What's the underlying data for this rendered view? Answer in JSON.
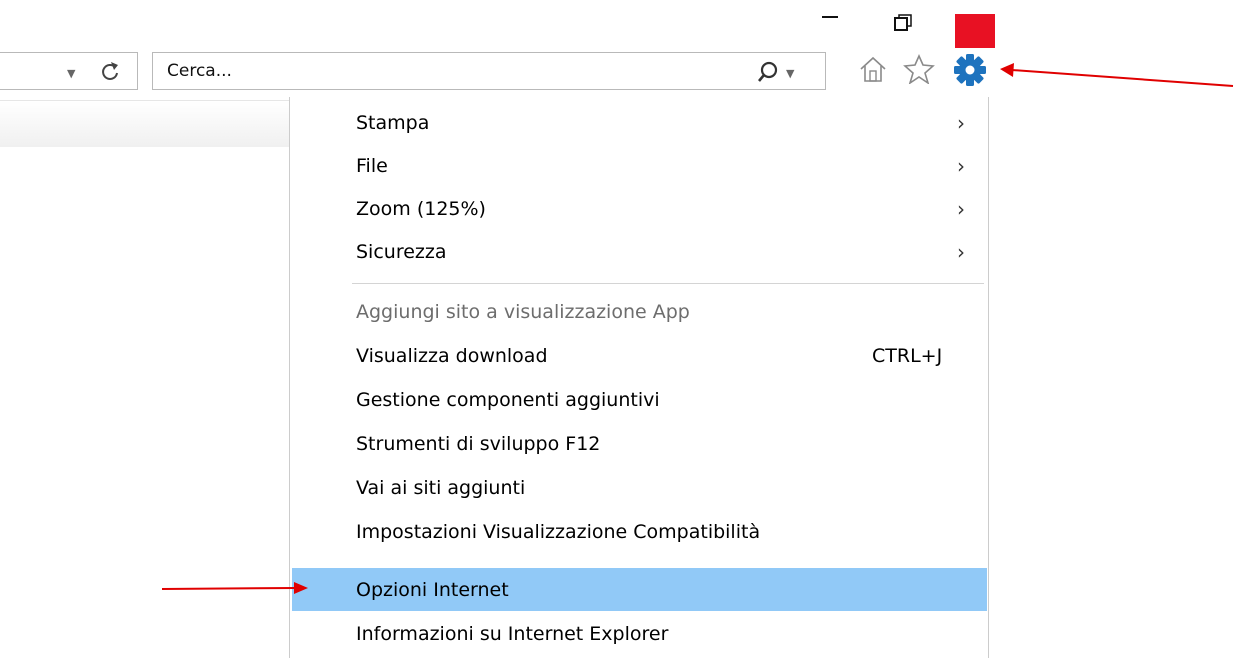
{
  "search": {
    "placeholder": "Cerca..."
  },
  "toolbar": {
    "icons": [
      "home-icon",
      "star-icon",
      "gear-icon"
    ],
    "gear_color": "#1e73be"
  },
  "window": {
    "close_color": "#e81123"
  },
  "menu": {
    "items": [
      {
        "label": "Stampa",
        "submenu": true
      },
      {
        "label": "File",
        "submenu": true
      },
      {
        "label": "Zoom (125%)",
        "submenu": true
      },
      {
        "label": "Sicurezza",
        "submenu": true
      },
      {
        "label": "Aggiungi sito a visualizzazione App",
        "disabled": true
      },
      {
        "label": "Visualizza download",
        "shortcut": "CTRL+J"
      },
      {
        "label": "Gestione componenti aggiuntivi"
      },
      {
        "label": "Strumenti di sviluppo F12"
      },
      {
        "label": "Vai ai siti aggiunti"
      },
      {
        "label": "Impostazioni Visualizzazione Compatibilità"
      },
      {
        "label": "Opzioni Internet",
        "highlighted": true
      },
      {
        "label": "Informazioni su Internet Explorer"
      }
    ],
    "highlight_color": "#91c9f7"
  },
  "annotations": {
    "arrow_color": "#e00000"
  }
}
